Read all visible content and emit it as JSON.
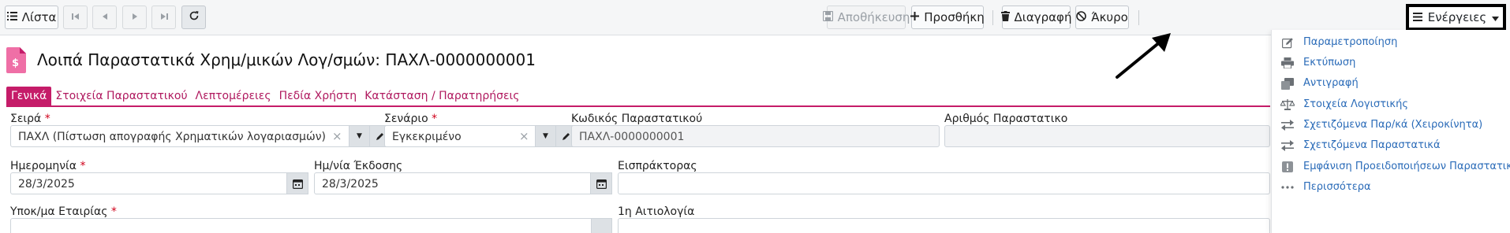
{
  "toolbar": {
    "list_label": "Λίστα",
    "save_label": "Αποθήκευση",
    "add_label": "Προσθήκη",
    "delete_label": "Διαγραφή",
    "cancel_label": "Άκυρο",
    "actions_label": "Ενέργειες"
  },
  "header": {
    "title": "Λοιπά Παραστατικά Χρημ/μικών Λογ/σμών: ΠΑΧΛ-0000000001"
  },
  "tabs": [
    {
      "label": "Γενικά"
    },
    {
      "label": "Στοιχεία Παραστατικού"
    },
    {
      "label": "Λεπτομέρειες"
    },
    {
      "label": "Πεδία Χρήστη"
    },
    {
      "label": "Κατάσταση / Παρατηρήσεις"
    }
  ],
  "form": {
    "series_label": "Σειρά",
    "series_value": "ΠΑΧΛ (Πίστωση απογραφής Χρηματικών λογαριασμών)",
    "scenario_label": "Σενάριο",
    "scenario_value": "Εγκεκριμένο",
    "doc_code_label": "Κωδικός Παραστατικού",
    "doc_code_value": "ΠΑΧΛ-0000000001",
    "doc_number_label": "Αριθμός Παραστατικο",
    "date_label": "Ημερομηνία",
    "date_value": "28/3/2025",
    "issue_date_label": "Ημ/νία Έκδοσης",
    "issue_date_value": "28/3/2025",
    "collector_label": "Εισπράκτορας",
    "branch_label": "Υποκ/μα Εταιρίας",
    "reason_label": "1η Αιτιολογία",
    "required_mark": "*"
  },
  "actions_menu": [
    {
      "label": "Παραμετροποίηση",
      "icon": "edit-icon"
    },
    {
      "label": "Εκτύπωση",
      "icon": "printer-icon"
    },
    {
      "label": "Αντιγραφή",
      "icon": "copy-icon"
    },
    {
      "label": "Στοιχεία Λογιστικής",
      "icon": "balance-scale-icon"
    },
    {
      "label": "Σχετιζόμενα Παρ/κά (Χειροκίνητα)",
      "icon": "exchange-icon"
    },
    {
      "label": "Σχετιζόμενα Παραστατικά",
      "icon": "exchange-icon"
    },
    {
      "label": "Εμφάνιση Προειδοποιήσεων Παραστατικού",
      "icon": "warning-icon"
    },
    {
      "label": "Περισσότερα",
      "icon": "more-icon"
    }
  ],
  "colors": {
    "accent": "#c51c69",
    "link": "#2a6bb8"
  }
}
